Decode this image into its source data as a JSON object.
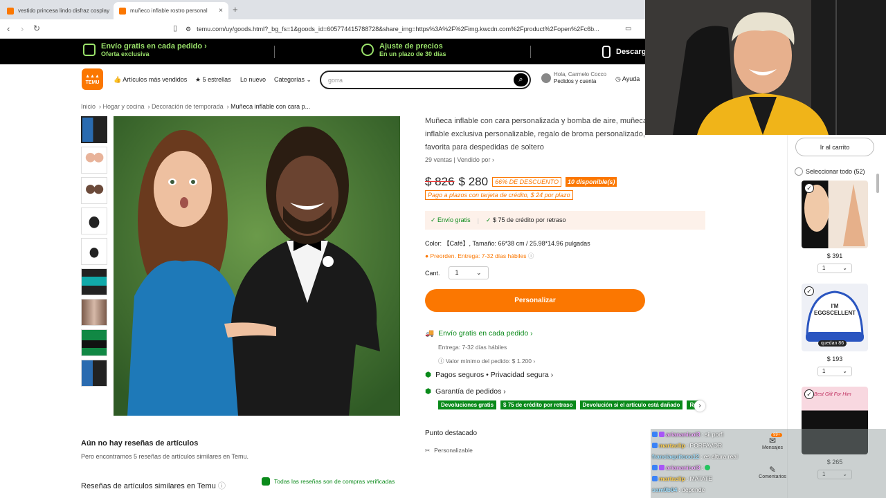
{
  "browser": {
    "tabs": [
      {
        "label": "vestido princesa lindo disfraz cosplay",
        "active": false
      },
      {
        "label": "muñeco inflable rostro personal",
        "active": true
      }
    ],
    "tab_close": "×",
    "new_tab": "+",
    "url": "temu.com/uy/goods.html?_bg_fs=1&goods_id=605774415788728&share_img=https%3A%2F%2Fimg.kwcdn.com%2Fproduct%2Fopen%2Fc6b..."
  },
  "promo": {
    "item1_title": "Envío gratis en cada pedido ›",
    "item1_sub": "Oferta exclusiva",
    "item2_title": "Ajuste de precios",
    "item2_sub": "En un plazo de 30 días",
    "item3_title": "Descarg"
  },
  "header": {
    "logo": "TEMU",
    "nav": [
      "Artículos más vendidos",
      "5 estrellas",
      "Lo nuevo",
      "Categorías"
    ],
    "search_value": "gorra",
    "account_line1": "Hola, Carmelo Cocco",
    "account_line2": "Pedidos y cuenta",
    "help": "Ayuda"
  },
  "breadcrumb": [
    "Inicio",
    "Hogar y cocina",
    "Decoración de temporada",
    "Muñeca inflable con cara p..."
  ],
  "product": {
    "title": "Muñeca inflable con cara personalizada y bomba de aire, muñeca inflable exclusiva personalizable, regalo de broma personalizado, favorita para despedidas de soltero",
    "sales": "29 ventas",
    "sold_by": "Vendido por",
    "old_price": "$ 826",
    "price": "$ 280",
    "discount": "66% DE DESCUENTO",
    "stock": "10 disponible(s)",
    "installment": "Pago a plazos con tarjeta de crédito, $ 24 por plazo",
    "ship_free": "Envío gratis",
    "late_credit": "$ 75 de crédito por retraso",
    "color_line": "Color: 【Café】, Tamaño: 66*38 cm / 25.98*14.96 pulgadas",
    "preorder": "Preorden. Entrega: 7-32 días hábiles",
    "qty_label": "Cant.",
    "qty_value": "1",
    "customize_btn": "Personalizar",
    "ship_each": "Envío gratis en cada pedido ›",
    "delivery": "Entrega: 7-32 días hábiles",
    "min_value": "Valor mínimo del pedido: $ 1.200 ›",
    "secure": "Pagos seguros • Privacidad segura ›",
    "guarantee": "Garantía de pedidos ›",
    "badges": [
      "Devoluciones gratis",
      "$ 75 de crédito por retraso",
      "Devolución si el artículo está dañado",
      "Reembolso"
    ],
    "highlight_title": "Punto destacado",
    "highlight_item": "Personalizable"
  },
  "reviews": {
    "none_title": "Aún no hay reseñas de artículos",
    "none_text": "Pero encontramos 5 reseñas de artículos similares en Temu.",
    "similar_title": "Reseñas de artículos similares en Temu",
    "verified": "Todas las reseñas son de compras verificadas"
  },
  "cart": {
    "go_cart": "Ir al carrito",
    "select_all": "Seleccionar todo (52)",
    "items": [
      {
        "price": "$ 391",
        "qty": "1"
      },
      {
        "price": "$ 193",
        "qty": "1",
        "tag": "quedan 86",
        "cap_text": "I'M EGGSCELLENT"
      },
      {
        "price": "$ 265",
        "qty": "1",
        "mug_text": "Best Gift For Him"
      }
    ]
  },
  "chat": {
    "lines": [
      {
        "user": "ariananicol3",
        "msg": ": sii porfi",
        "color": "#f0a0ff"
      },
      {
        "user": "martaclip",
        "msg": ": PORFAVOR",
        "color": "#ffd04d"
      },
      {
        "user": "franciaquitoco12",
        "msg": ": es altura real",
        "color": "#9fe0ff"
      },
      {
        "user": "ariananicol3",
        "msg": ":",
        "color": "#f0a0ff"
      },
      {
        "user": "martaclip",
        "msg": ": MATATE",
        "color": "#ffd04d"
      },
      {
        "user": "sam9b04",
        "msg": ": depende",
        "color": "#9fe0ff"
      }
    ],
    "messages_label": "Mensajes",
    "messages_badge": "99+",
    "comments_label": "Comentarios"
  }
}
